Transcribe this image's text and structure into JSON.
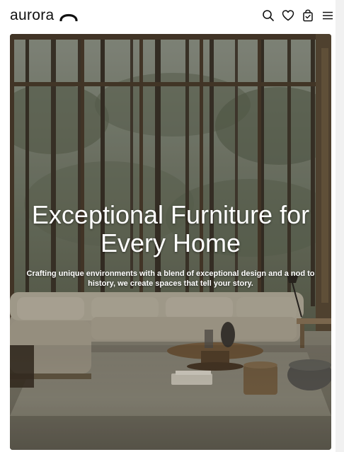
{
  "brand": {
    "name": "aurora",
    "logo_icon": "arch-icon"
  },
  "header": {
    "icons": [
      "search-icon",
      "heart-icon",
      "shopping-bag-icon",
      "menu-icon"
    ]
  },
  "hero": {
    "title": "Exceptional Furniture for Every Home",
    "subtitle": "Crafting unique environments with a blend of exceptional design and a nod to history, we create spaces that tell your story."
  }
}
